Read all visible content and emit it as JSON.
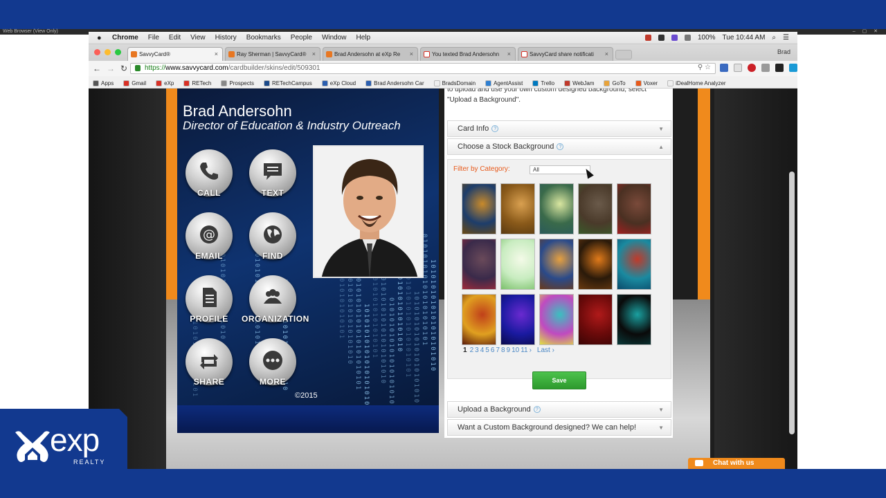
{
  "outer": {
    "view_only_label": "Web Browser (View Only)",
    "window_controls": "– ▢ ✕"
  },
  "mac_menu": {
    "items": [
      "Chrome",
      "File",
      "Edit",
      "View",
      "History",
      "Bookmarks",
      "People",
      "Window",
      "Help"
    ],
    "battery": "100%",
    "clock": "Tue 10:44 AM"
  },
  "tabs": [
    {
      "label": "SavvyCard®",
      "active": true,
      "icon": "savvycard"
    },
    {
      "label": "Ray Sherman | SavvyCard®",
      "active": false,
      "icon": "savvycard"
    },
    {
      "label": "Brad Andersohn at eXp Re",
      "active": false,
      "icon": "savvycard"
    },
    {
      "label": "You texted Brad Andersohn",
      "active": false,
      "icon": "gmail"
    },
    {
      "label": "SavvyCard share notificati",
      "active": false,
      "icon": "gmail"
    }
  ],
  "profile": "Brad",
  "address": {
    "scheme": "https://",
    "host": "www.savvycard.com",
    "path": "/cardbuilder/skins/edit/509301"
  },
  "bookmarks": [
    {
      "label": "Apps",
      "color": "#555555"
    },
    {
      "label": "Gmail",
      "color": "#d93025"
    },
    {
      "label": "eXp",
      "color": "#d93025"
    },
    {
      "label": "RETech",
      "color": "#d93025"
    },
    {
      "label": "Prospects",
      "color": "#888888"
    },
    {
      "label": "RETechCampus",
      "color": "#1b4a8a"
    },
    {
      "label": "eXp Cloud",
      "color": "#2b5fb0"
    },
    {
      "label": "Brad Andersohn Car",
      "color": "#2b5fb0"
    },
    {
      "label": "BradsDomain",
      "color": "#eeeeee"
    },
    {
      "label": "AgentAssist",
      "color": "#2f7fd1"
    },
    {
      "label": "Trello",
      "color": "#0079bf"
    },
    {
      "label": "WebJam",
      "color": "#c0392b"
    },
    {
      "label": "GoTo",
      "color": "#e8a33a"
    },
    {
      "label": "Voxer",
      "color": "#e8591a"
    },
    {
      "label": "iDealHome Analyzer",
      "color": "#eeeeee"
    }
  ],
  "card": {
    "name": "Brad Andersohn",
    "title": "Director of Education & Industry Outreach",
    "buttons": [
      {
        "label": "CALL",
        "icon": "phone-icon"
      },
      {
        "label": "TEXT",
        "icon": "chat-bubble-icon"
      },
      {
        "label": "EMAIL",
        "icon": "at-sign-icon"
      },
      {
        "label": "FIND",
        "icon": "globe-icon"
      },
      {
        "label": "PROFILE",
        "icon": "document-icon"
      },
      {
        "label": "ORGANIZATION",
        "icon": "people-icon"
      },
      {
        "label": "SHARE",
        "icon": "share-arrows-icon"
      },
      {
        "label": "MORE",
        "icon": "ellipsis-icon"
      }
    ],
    "copyright": "©2015"
  },
  "panel": {
    "intro": "to upload and use your own custom designed background, select \"Upload a Background\".",
    "sections": {
      "card_info": "Card Info",
      "stock_background": "Choose a Stock Background",
      "upload": "Upload a Background",
      "custom": "Want a Custom Background designed? We can help!"
    },
    "filter_label": "Filter by Category:",
    "filter_value": "All",
    "thumbnails": [
      {
        "name": "wheat-field",
        "colors": [
          "#1d3d6b",
          "#c98a2a",
          "#6b4a12"
        ]
      },
      {
        "name": "wheat-closeup",
        "colors": [
          "#8a5a1a",
          "#d9a050",
          "#5a3a10"
        ]
      },
      {
        "name": "green-glow",
        "colors": [
          "#3a6a4a",
          "#d9e6a0",
          "#2a5a5a"
        ]
      },
      {
        "name": "wood-leaf",
        "colors": [
          "#4a3a2a",
          "#6a5a4a",
          "#3a5a2a"
        ]
      },
      {
        "name": "wood-red-flower",
        "colors": [
          "#4a3022",
          "#7a4a3a",
          "#a02020"
        ]
      },
      {
        "name": "purple-wood-floral",
        "colors": [
          "#3a2a4a",
          "#6a4a5a",
          "#a02a3a"
        ]
      },
      {
        "name": "green-leaves",
        "colors": [
          "#c8ecc0",
          "#f4fae8",
          "#7ac06a"
        ]
      },
      {
        "name": "sky-sunset",
        "colors": [
          "#2a4a8a",
          "#e6a040",
          "#6a3a1a"
        ]
      },
      {
        "name": "pumpkin",
        "colors": [
          "#2a1a0a",
          "#e07a1a",
          "#6a3a10"
        ]
      },
      {
        "name": "teal-red-abstract",
        "colors": [
          "#1a8aa0",
          "#c03a2a",
          "#0a4a6a"
        ]
      },
      {
        "name": "orange-swirl",
        "colors": [
          "#e0a020",
          "#c0401a",
          "#5a1a0a"
        ]
      },
      {
        "name": "blue-purple-wave",
        "colors": [
          "#1a1aa0",
          "#6a2ad0",
          "#0a0a4a"
        ]
      },
      {
        "name": "letter-t-graffiti",
        "colors": [
          "#c04ac0",
          "#3ac0c0",
          "#e0e040"
        ]
      },
      {
        "name": "red-curtain",
        "colors": [
          "#6a0a0a",
          "#b01a1a",
          "#3a0505"
        ]
      },
      {
        "name": "teal-splatter",
        "colors": [
          "#0a0a0a",
          "#1aa0a0",
          "#0a3a3a"
        ]
      }
    ],
    "pager": {
      "current": "1",
      "pages": [
        "2",
        "3",
        "4",
        "5",
        "6",
        "7",
        "8",
        "9",
        "10",
        "11"
      ],
      "next": "›",
      "last": "Last ›"
    },
    "save": "Save"
  },
  "chat_label": "Chat with us",
  "brand": {
    "text": "exp",
    "sub": "REALTY"
  },
  "colors": {
    "brand_blue": "#12398f",
    "accent_orange": "#f08a1c",
    "save_green": "#3aaa3a"
  }
}
